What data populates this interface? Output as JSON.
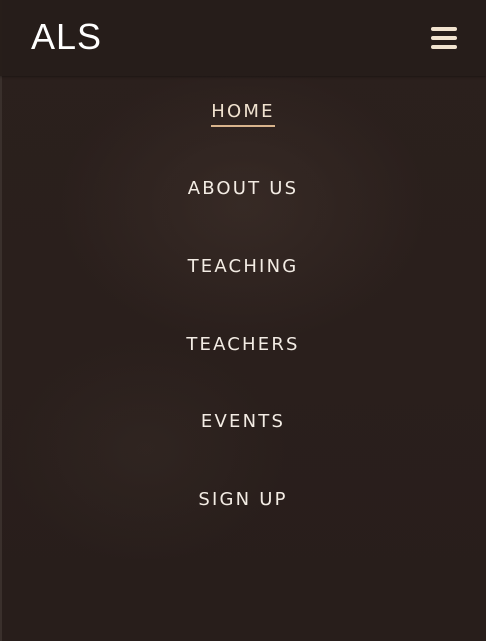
{
  "header": {
    "logo": "ALS",
    "menu_icon": "hamburger-menu-icon"
  },
  "nav": {
    "items": [
      {
        "label": "HOME",
        "active": true
      },
      {
        "label": "ABOUT US",
        "active": false
      },
      {
        "label": "TEACHING",
        "active": false
      },
      {
        "label": "TEACHERS",
        "active": false
      },
      {
        "label": "EVENTS",
        "active": false
      },
      {
        "label": "SIGN UP",
        "active": false
      }
    ]
  },
  "colors": {
    "background": "#2a1f1c",
    "header": "#261d1a",
    "text": "#f3ece4",
    "accent": "#d9b48c"
  }
}
